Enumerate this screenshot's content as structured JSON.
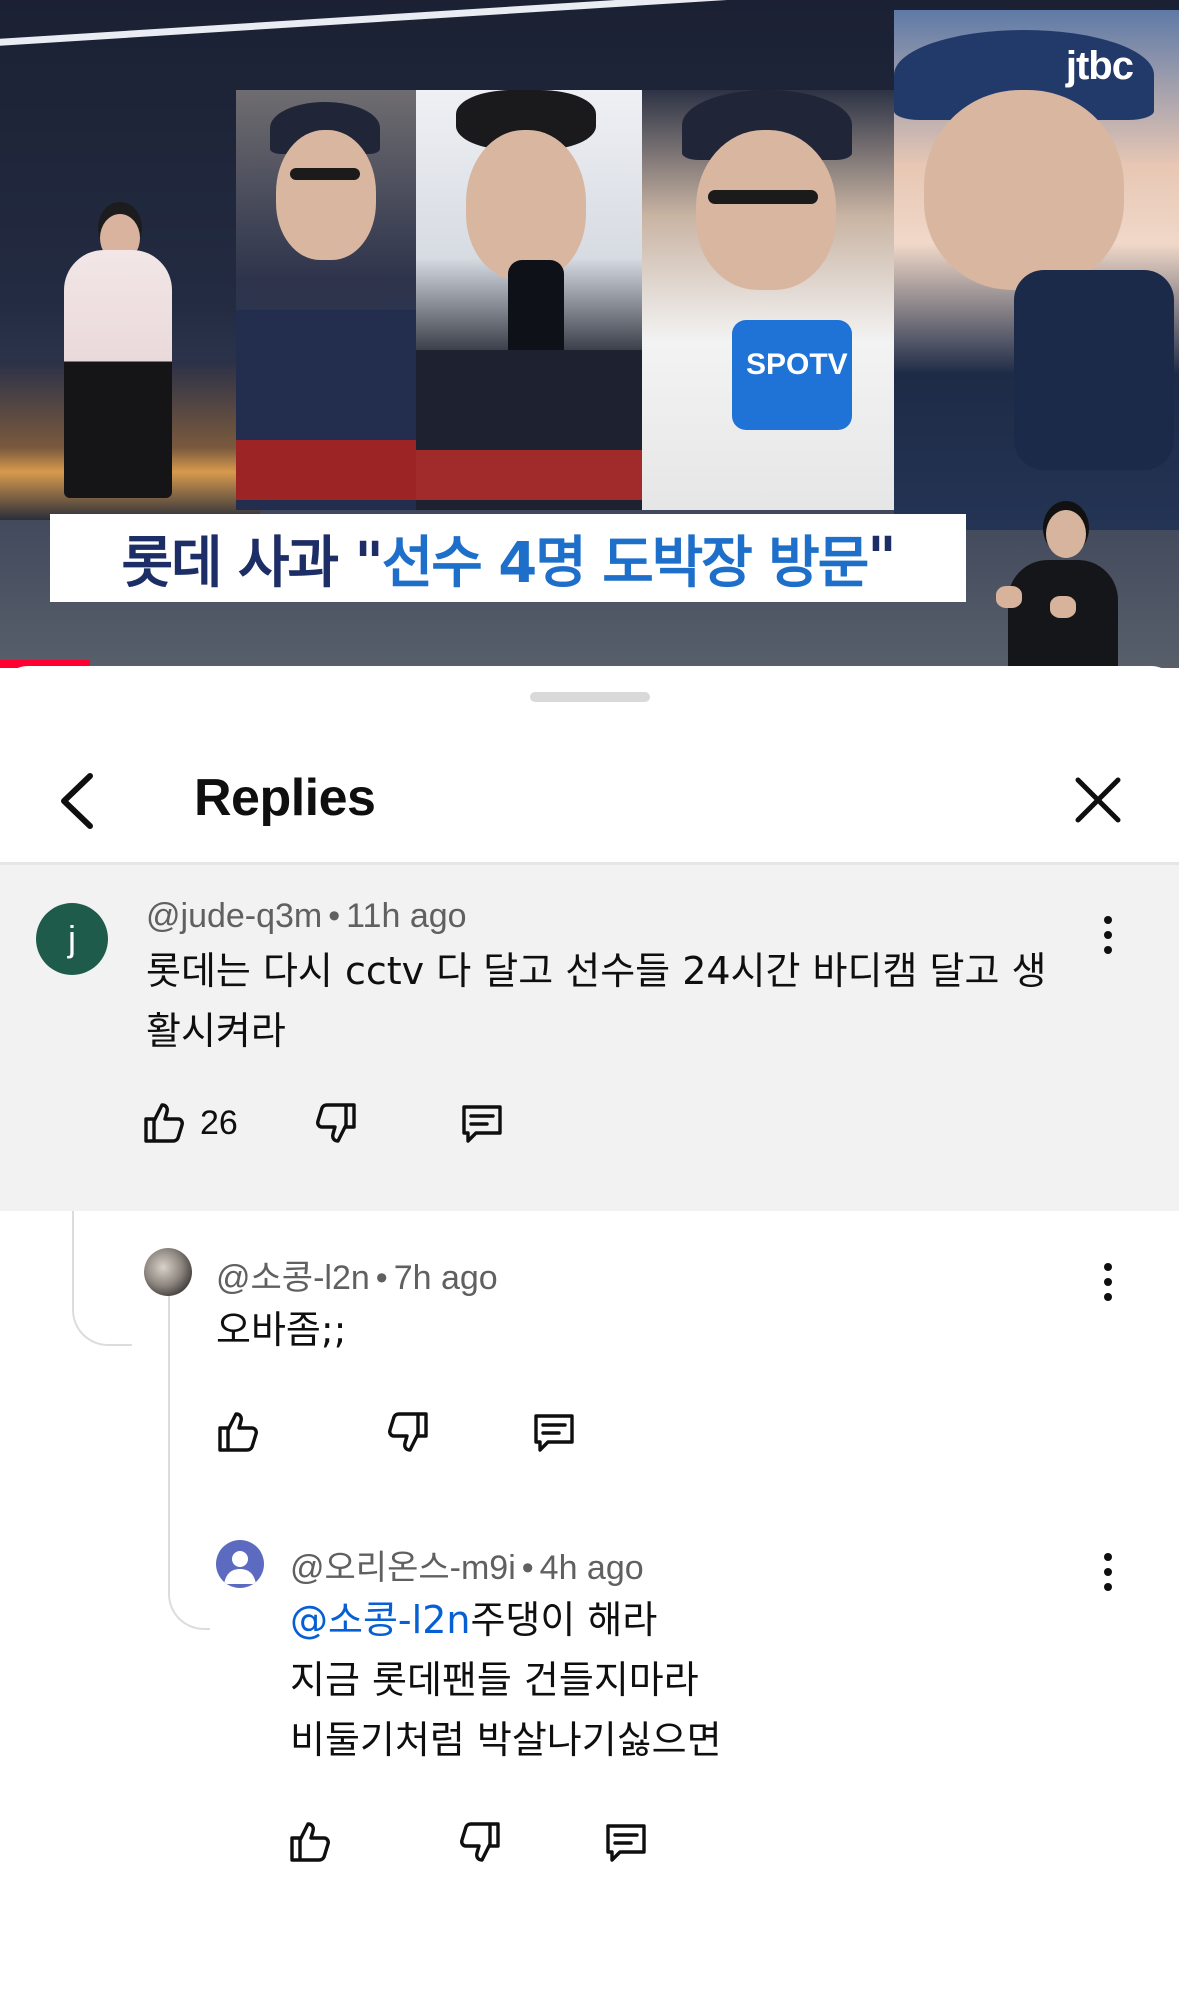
{
  "video": {
    "channel_logo": "jtbc",
    "caption_dark_1": "롯데 사과 \"",
    "caption_blue_1": "선수 4명",
    "caption_blue_2": "도박장 방문",
    "caption_dark_2": "\"",
    "progress_fraction": 0.076
  },
  "sheet": {
    "title": "Replies",
    "back_icon": "chevron-left-icon",
    "close_icon": "close-icon"
  },
  "comments": [
    {
      "avatar_letter": "j",
      "avatar_color": "#1e5b4b",
      "author": "@jude-q3m",
      "time": "11h ago",
      "text_line1": "롯데는 다시 cctv 다 달고 선수들 24시간 바디캠 달고 생",
      "text_line2": "활시켜라",
      "likes": "26"
    },
    {
      "author": "@소콩-l2n",
      "time": "7h ago",
      "text": "오바좀;;"
    },
    {
      "avatar_color": "#5c6bc0",
      "author": "@오리온스-m9i",
      "time": "4h ago",
      "mention": "@소콩-l2n",
      "text_line1": "주댕이 해라",
      "text_line2": "지금 롯데팬들 건들지마라",
      "text_line3": "비둘기처럼 박살나기싫으면"
    }
  ],
  "separator": "•",
  "colors": {
    "accent": "#065fd4",
    "progress": "#ff0033",
    "parent_bg": "#f2f2f2"
  }
}
